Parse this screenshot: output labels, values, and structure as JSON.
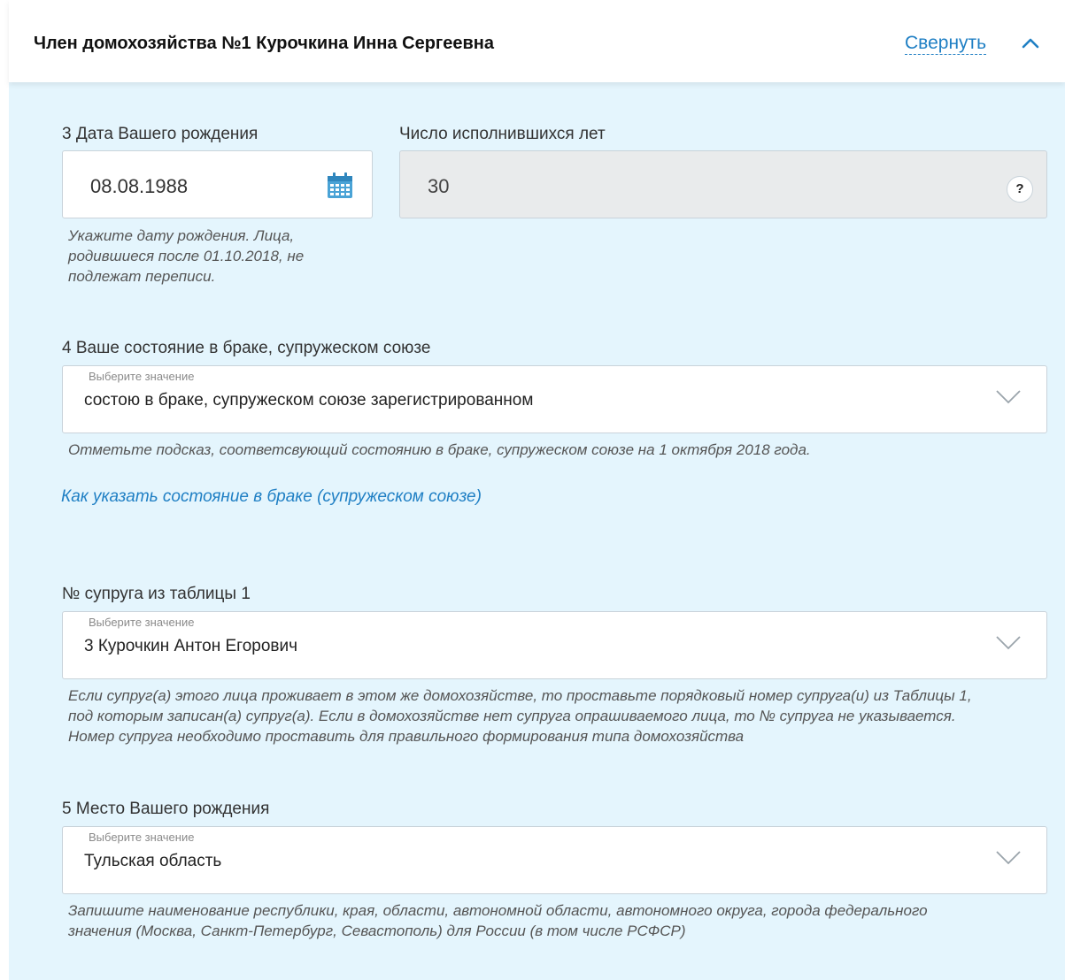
{
  "header": {
    "title": "Член домохозяйства №1 Курочкина Инна Сергеевна",
    "collapse_label": "Свернуть"
  },
  "birth_date": {
    "label": "3 Дата Вашего рождения",
    "value": "08.08.1988",
    "hint_lines": [
      "Укажите дату рождения. Лица,",
      "родившиеся после 01.10.2018, не",
      "подлежат переписи."
    ]
  },
  "age": {
    "label": "Число исполнившихся лет",
    "value": "30",
    "help": "?"
  },
  "marital": {
    "label": "4 Ваше состояние в браке, супружеском союзе",
    "placeholder": "Выберите значение",
    "value": "состою в браке, супружеском союзе зарегистрированном",
    "hint": "Отметьте подсказ, соответсвующий состоянию в браке, супружеском союзе на 1 октября 2018 года.",
    "help_link": "Как указать состояние в браке (супружеском союзе)"
  },
  "spouse": {
    "label": "№ супруга из таблицы 1",
    "placeholder": "Выберите значение",
    "value": "3 Курочкин Антон Егорович",
    "hint_lines": [
      "Если супруг(а) этого лица проживает в этом же домохозяйстве, то проставьте порядковый номер супруга(и) из Таблицы 1,",
      "под которым записан(а) супруг(а). Если в домохозяйстве нет супруга опрашиваемого лица, то № супруга не указывается.",
      "Номер супруга необходимо проставить для правильного формирования типа домохозяйства"
    ]
  },
  "birthplace": {
    "label": "5 Место Вашего рождения",
    "placeholder": "Выберите значение",
    "value": "Тульская область",
    "hint_lines": [
      "Запишите наименование республики, края, области, автономной области, автономного округа, города федерального",
      "значения (Москва, Санкт-Петербург, Севастополь) для России (в том числе РСФСР)"
    ]
  },
  "colors": {
    "accent": "#1f7fc4",
    "panel_bg": "#e4f5fd",
    "disabled_bg": "#e9ebec"
  }
}
